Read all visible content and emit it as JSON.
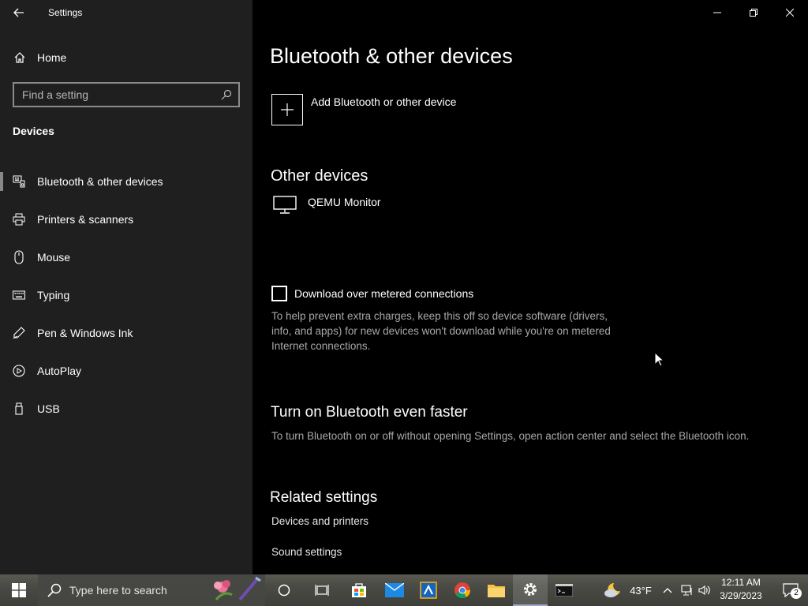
{
  "window": {
    "title": "Settings"
  },
  "sidebar": {
    "home_label": "Home",
    "search_placeholder": "Find a setting",
    "section_title": "Devices",
    "items": [
      {
        "label": "Bluetooth & other devices",
        "icon": "bluetooth-devices-icon"
      },
      {
        "label": "Printers & scanners",
        "icon": "printer-icon"
      },
      {
        "label": "Mouse",
        "icon": "mouse-icon"
      },
      {
        "label": "Typing",
        "icon": "keyboard-icon"
      },
      {
        "label": "Pen & Windows Ink",
        "icon": "pen-icon"
      },
      {
        "label": "AutoPlay",
        "icon": "autoplay-icon"
      },
      {
        "label": "USB",
        "icon": "usb-icon"
      }
    ],
    "selected_index": 0
  },
  "main": {
    "page_title": "Bluetooth & other devices",
    "add_device_label": "Add Bluetooth or other device",
    "other_devices_title": "Other devices",
    "devices": [
      {
        "label": "QEMU Monitor",
        "icon": "monitor-icon"
      }
    ],
    "metered": {
      "label": "Download over metered connections",
      "checked": false,
      "description": "To help prevent extra charges, keep this off so device software (drivers, info, and apps) for new devices won't download while you're on metered Internet connections."
    },
    "faster": {
      "title": "Turn on Bluetooth even faster",
      "description": "To turn Bluetooth on or off without opening Settings, open action center and select the Bluetooth icon."
    },
    "related": {
      "title": "Related settings",
      "links": [
        "Devices and printers",
        "Sound settings"
      ]
    }
  },
  "taskbar": {
    "search_text": "Type here to search",
    "weather": "43°F",
    "time": "12:11 AM",
    "date": "3/29/2023",
    "notifications": "2"
  },
  "colors": {
    "sidebar_bg": "#1f1f1f",
    "main_bg": "#000000",
    "secondary_text": "#a8a8a8",
    "selection_bar": "#888888"
  }
}
